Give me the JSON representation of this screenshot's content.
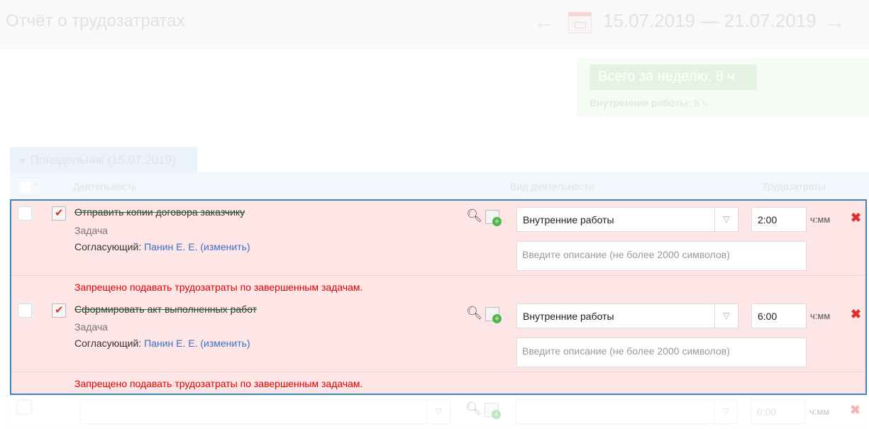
{
  "header": {
    "title": "Отчёт о трудозатратах",
    "date_range": "15.07.2019 — 21.07.2019",
    "prev": "←",
    "next": "→"
  },
  "summary": {
    "total": "Всего за неделю: 8 ч",
    "breakdown_label": "Внутренние работы:",
    "breakdown_value": "8 ч"
  },
  "day": {
    "label": "Понедельник (15.07.2019)"
  },
  "columns": {
    "activity": "Деятельность",
    "activity_type": "Вид деятельности",
    "effort": "Трудозатраты"
  },
  "rows": [
    {
      "name": "Отправить копии договора заказчику",
      "type": "Задача",
      "approver_label": "Согласующий:",
      "approver": "Панин Е. Е.",
      "change": "изменить",
      "activity_type": "Внутренние работы",
      "time": "2:00",
      "unit": "ч:мм",
      "desc_placeholder": "Введите описание (не более 2000 символов)",
      "error": "Запрещено подавать трудозатраты по завершенным задачам."
    },
    {
      "name": "Сформировать акт выполненных работ",
      "type": "Задача",
      "approver_label": "Согласующий:",
      "approver": "Панин Е. Е.",
      "change": "изменить",
      "activity_type": "Внутренние работы",
      "time": "6:00",
      "unit": "ч:мм",
      "desc_placeholder": "Введите описание (не более 2000 символов)",
      "error": "Запрещено подавать трудозатраты по завершенным задачам."
    }
  ],
  "new_row": {
    "time_placeholder": "0:00",
    "unit": "ч:мм"
  }
}
